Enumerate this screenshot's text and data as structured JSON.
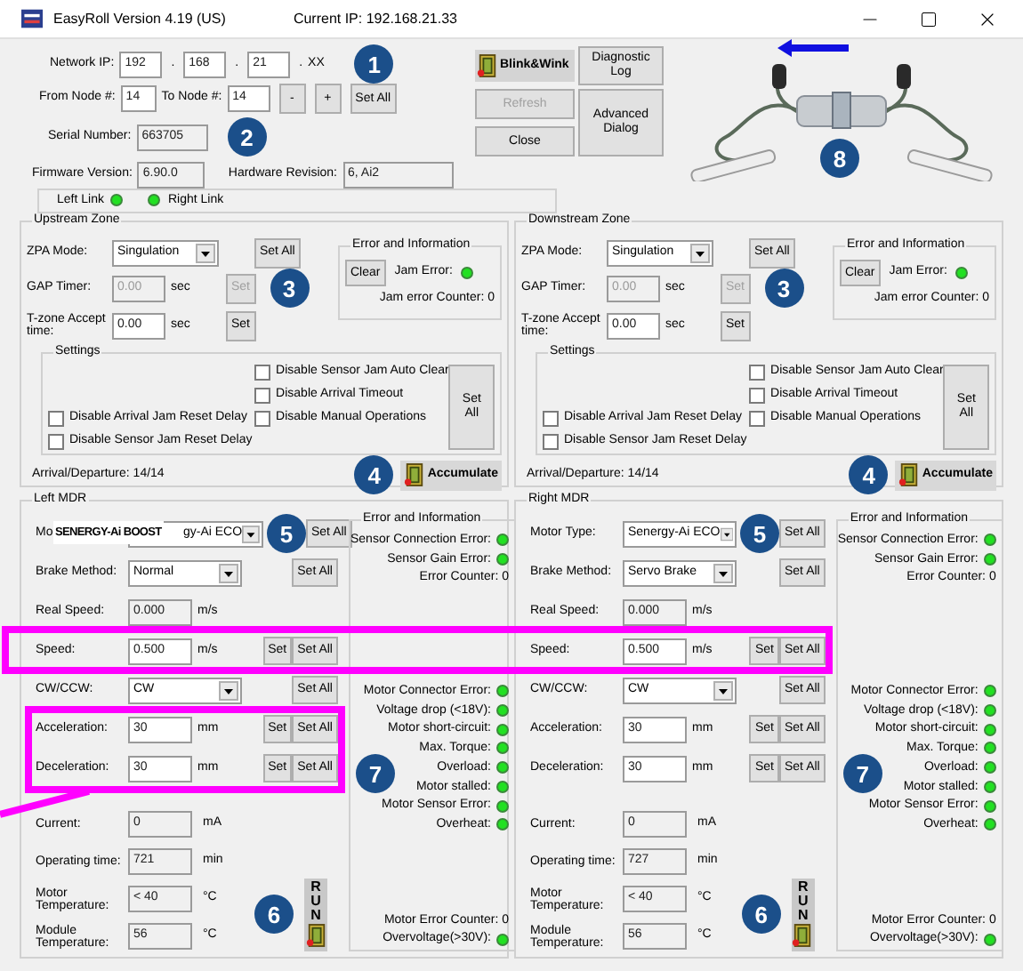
{
  "window": {
    "title": "EasyRoll Version 4.19 (US)",
    "current_ip": "Current IP: 192.168.21.33"
  },
  "network": {
    "label": "Network IP:",
    "octets": [
      "192",
      "168",
      "21"
    ],
    "separator": ".",
    "tail": "XX",
    "badge": "1"
  },
  "nodes": {
    "from_label": "From Node #:",
    "from": "14",
    "to_label": "To Node #:",
    "to": "14",
    "buttons": [
      "-",
      "+",
      "Set All"
    ]
  },
  "serial": {
    "label": "Serial Number:",
    "value": "663705",
    "badge": "2"
  },
  "firmware": {
    "label": "Firmware Version:",
    "value": "6.90.0"
  },
  "hardware": {
    "label": "Hardware Revision:",
    "value": "6, Ai2"
  },
  "left_buttons": [
    {
      "label": "Blink&Wink",
      "kind": "icon",
      "disabled": false
    },
    {
      "label": "Refresh",
      "kind": "plain",
      "disabled": true
    },
    {
      "label": "Close",
      "kind": "plain",
      "disabled": false
    }
  ],
  "right_buttons": [
    {
      "label": "Diagnostic Log",
      "kind": "short"
    },
    {
      "label": "Advanced Dialog",
      "kind": "tall"
    }
  ],
  "device": {
    "badge": "8"
  },
  "links": [
    {
      "label": "Left Link",
      "on": true,
      "kind": "dot-after"
    },
    {
      "label": "Right Link",
      "on": true,
      "kind": "dot-before"
    }
  ],
  "zones": [
    {
      "title": "Upstream Zone",
      "zpa_label": "ZPA Mode:",
      "zpa": "Singulation",
      "set_all": "Set All",
      "gap_label": "GAP Timer:",
      "gap": "0.00",
      "gap_unit": "sec",
      "gap_set": "Set",
      "gap_disabled": true,
      "tzone_label": "T-zone Accept time:",
      "tzone": "0.00",
      "tzone_unit": "sec",
      "tzone_set": "Set",
      "badge": "3",
      "error": {
        "title": "Error and Information",
        "clear": "Clear",
        "jam_label": "Jam Error:",
        "jam_on": true,
        "counter": "Jam error Counter: 0"
      },
      "settings": {
        "title": "Settings",
        "right_checks": [
          {
            "label": "Disable Sensor Jam Auto Clear",
            "checked": false
          },
          {
            "label": "Disable Arrival Timeout",
            "checked": false
          },
          {
            "label": "Disable Manual Operations",
            "checked": false
          }
        ],
        "left_checks": [
          {
            "label": "Disable Arrival Jam Reset Delay",
            "checked": false
          },
          {
            "label": "Disable Sensor Jam Reset Delay",
            "checked": false
          }
        ],
        "set_all": "Set All"
      },
      "arrival": "Arrival/Departure: 14/14",
      "badge2": "4",
      "accumulate": "Accumulate"
    },
    {
      "title": "Downstream Zone",
      "zpa_label": "ZPA Mode:",
      "zpa": "Singulation",
      "set_all": "Set All",
      "gap_label": "GAP Timer:",
      "gap": "0.00",
      "gap_unit": "sec",
      "gap_set": "Set",
      "gap_disabled": true,
      "tzone_label": "T-zone Accept time:",
      "tzone": "0.00",
      "tzone_unit": "sec",
      "tzone_set": "Set",
      "badge": "3",
      "error": {
        "title": "Error and Information",
        "clear": "Clear",
        "jam_label": "Jam Error:",
        "jam_on": true,
        "counter": "Jam error Counter: 0"
      },
      "settings": {
        "title": "Settings",
        "right_checks": [
          {
            "label": "Disable Sensor Jam Auto Clear",
            "checked": false
          },
          {
            "label": "Disable Arrival Timeout",
            "checked": false
          },
          {
            "label": "Disable Manual Operations",
            "checked": false
          }
        ],
        "left_checks": [
          {
            "label": "Disable Arrival Jam Reset Delay",
            "checked": false
          },
          {
            "label": "Disable Sensor Jam Reset Delay",
            "checked": false
          }
        ],
        "set_all": "Set All"
      },
      "arrival": "Arrival/Departure: 14/14",
      "badge2": "4",
      "accumulate": "Accumulate"
    }
  ],
  "mdrs": [
    {
      "title": "Left MDR",
      "badge_motor": "5",
      "badge_error": "7",
      "badge_run": "6",
      "run": "RUN",
      "settings_rows": [
        {
          "kind": "select",
          "label": "Mo",
          "overlay": "SENERGY-Ai BOOST",
          "value": "gy-Ai ECO",
          "buttons": [
            "Set All"
          ]
        },
        {
          "kind": "select",
          "label": "Brake Method:",
          "value": "Normal",
          "buttons": [
            "Set All"
          ]
        },
        {
          "kind": "input",
          "label": "Real Speed:",
          "value": "0.000",
          "unit": "m/s",
          "disabled": true,
          "buttons": []
        },
        {
          "kind": "input",
          "label": "Speed:",
          "value": "0.500",
          "unit": "m/s",
          "disabled": false,
          "buttons": [
            "Set",
            "Set All"
          ]
        },
        {
          "kind": "select",
          "label": "CW/CCW:",
          "value": "CW",
          "buttons": [
            "Set All"
          ]
        },
        {
          "kind": "input",
          "label": "Acceleration:",
          "value": "30",
          "unit": "mm",
          "disabled": false,
          "buttons": [
            "Set",
            "Set All"
          ]
        },
        {
          "kind": "input",
          "label": "Deceleration:",
          "value": "30",
          "unit": "mm",
          "disabled": false,
          "buttons": [
            "Set",
            "Set All"
          ]
        }
      ],
      "readout_rows": [
        {
          "label": "Current:",
          "value": "0",
          "unit": "mA"
        },
        {
          "label": "Operating time:",
          "value": "721",
          "unit": "min"
        },
        {
          "label": "Motor Temperature:",
          "value": "< 40",
          "unit": "°C"
        },
        {
          "label": "Module Temperature:",
          "value": "56",
          "unit": "°C"
        }
      ],
      "error": {
        "title": "Error and Information",
        "groups": [
          [
            {
              "kind": "indicator",
              "label": "Sensor Connection Error:",
              "on": true
            },
            {
              "kind": "indicator",
              "label": "Sensor Gain Error:",
              "on": true
            },
            {
              "kind": "counter",
              "label": "Error Counter: 0"
            }
          ],
          [
            {
              "kind": "indicator",
              "label": "Motor Connector Error:",
              "on": true
            },
            {
              "kind": "indicator",
              "label": "Voltage drop (<18V):",
              "on": true
            },
            {
              "kind": "indicator",
              "label": "Motor short-circuit:",
              "on": true
            },
            {
              "kind": "indicator",
              "label": "Max. Torque:",
              "on": true
            },
            {
              "kind": "indicator",
              "label": "Overload:",
              "on": true
            },
            {
              "kind": "indicator",
              "label": "Motor stalled:",
              "on": true
            },
            {
              "kind": "indicator",
              "label": "Motor Sensor Error:",
              "on": true
            },
            {
              "kind": "indicator",
              "label": "Overheat:",
              "on": true
            }
          ],
          [
            {
              "kind": "counter",
              "label": "Motor Error Counter: 0"
            },
            {
              "kind": "indicator",
              "label": "Overvoltage(>30V):",
              "on": true
            }
          ]
        ]
      }
    },
    {
      "title": "Right MDR",
      "badge_motor": "5",
      "badge_error": "7",
      "badge_run": "6",
      "run": "RUN",
      "settings_rows": [
        {
          "kind": "select",
          "label": "Motor Type:",
          "value": "Senergy-Ai ECO",
          "buttons": [
            "Set All"
          ]
        },
        {
          "kind": "select",
          "label": "Brake Method:",
          "value": "Servo Brake",
          "buttons": [
            "Set All"
          ]
        },
        {
          "kind": "input",
          "label": "Real Speed:",
          "value": "0.000",
          "unit": "m/s",
          "disabled": true,
          "buttons": []
        },
        {
          "kind": "input",
          "label": "Speed:",
          "value": "0.500",
          "unit": "m/s",
          "disabled": false,
          "buttons": [
            "Set",
            "Set All"
          ]
        },
        {
          "kind": "select",
          "label": "CW/CCW:",
          "value": "CW",
          "buttons": [
            "Set All"
          ]
        },
        {
          "kind": "input",
          "label": "Acceleration:",
          "value": "30",
          "unit": "mm",
          "disabled": false,
          "buttons": [
            "Set",
            "Set All"
          ]
        },
        {
          "kind": "input",
          "label": "Deceleration:",
          "value": "30",
          "unit": "mm",
          "disabled": false,
          "buttons": [
            "Set",
            "Set All"
          ]
        }
      ],
      "readout_rows": [
        {
          "label": "Current:",
          "value": "0",
          "unit": "mA"
        },
        {
          "label": "Operating time:",
          "value": "727",
          "unit": "min"
        },
        {
          "label": "Motor Temperature:",
          "value": "< 40",
          "unit": "°C"
        },
        {
          "label": "Module Temperature:",
          "value": "56",
          "unit": "°C"
        }
      ],
      "error": {
        "title": "Error and Information",
        "groups": [
          [
            {
              "kind": "indicator",
              "label": "Sensor Connection Error:",
              "on": true
            },
            {
              "kind": "indicator",
              "label": "Sensor Gain Error:",
              "on": true
            },
            {
              "kind": "counter",
              "label": "Error Counter: 0"
            }
          ],
          [
            {
              "kind": "indicator",
              "label": "Motor Connector Error:",
              "on": true
            },
            {
              "kind": "indicator",
              "label": "Voltage drop (<18V):",
              "on": true
            },
            {
              "kind": "indicator",
              "label": "Motor short-circuit:",
              "on": true
            },
            {
              "kind": "indicator",
              "label": "Max. Torque:",
              "on": true
            },
            {
              "kind": "indicator",
              "label": "Overload:",
              "on": true
            },
            {
              "kind": "indicator",
              "label": "Motor stalled:",
              "on": true
            },
            {
              "kind": "indicator",
              "label": "Motor Sensor Error:",
              "on": true
            },
            {
              "kind": "indicator",
              "label": "Overheat:",
              "on": true
            }
          ],
          [
            {
              "kind": "counter",
              "label": "Motor Error Counter: 0"
            },
            {
              "kind": "indicator",
              "label": "Overvoltage(>30V):",
              "on": true
            }
          ]
        ]
      }
    }
  ]
}
